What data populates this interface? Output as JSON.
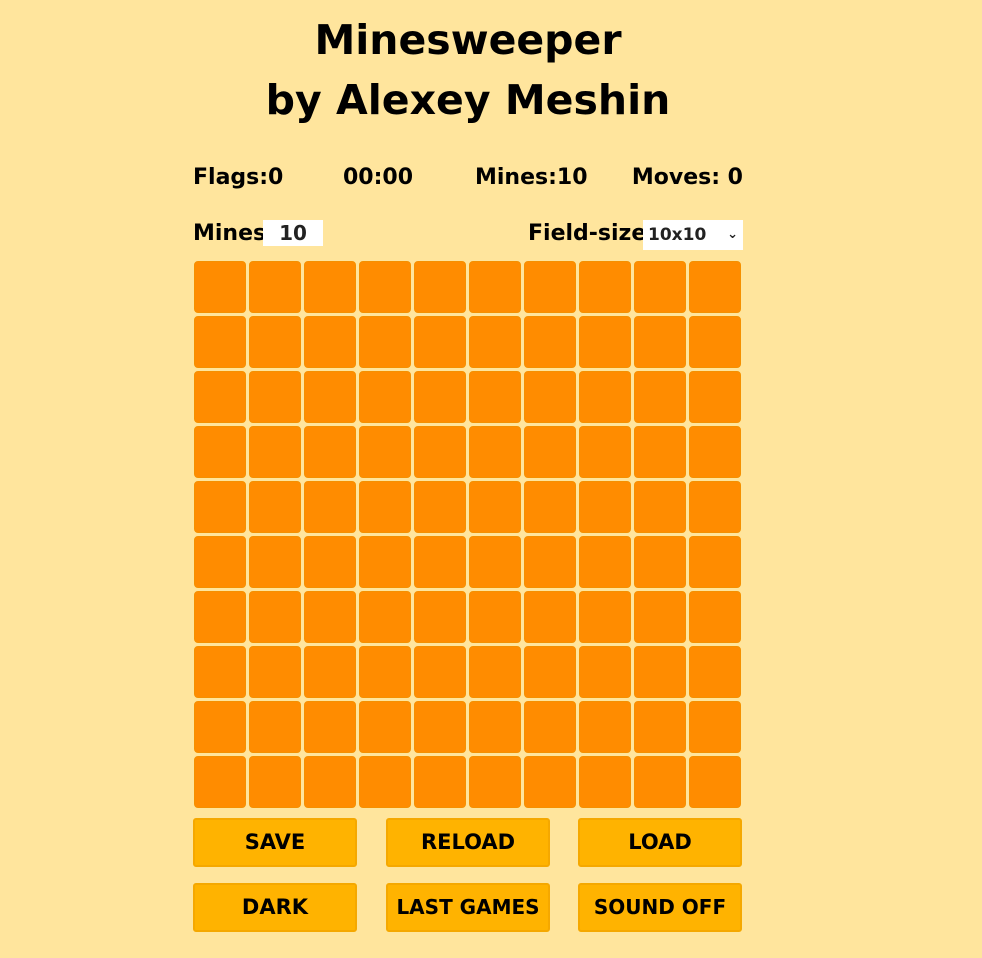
{
  "header": {
    "title_line1": "Minesweeper",
    "title_line2": "by Alexey Meshin"
  },
  "stats": {
    "flags": "Flags:0",
    "timer": "00:00",
    "mines": "Mines:10",
    "moves": "Moves: 0"
  },
  "controls": {
    "mines_label": "Mines",
    "mines_value": "10",
    "size_label": "Field-size:",
    "size_selected": "10x10"
  },
  "board": {
    "rows": 10,
    "cols": 10,
    "cell_color": "#ff8c00"
  },
  "buttons": {
    "save": "SAVE",
    "reload": "RELOAD",
    "load": "LOAD",
    "dark": "DARK",
    "last_games": "LAST GAMES",
    "sound": "SOUND OFF"
  },
  "colors": {
    "background": "#ffe59d",
    "button": "#ffb300",
    "cell": "#ff8c00"
  }
}
